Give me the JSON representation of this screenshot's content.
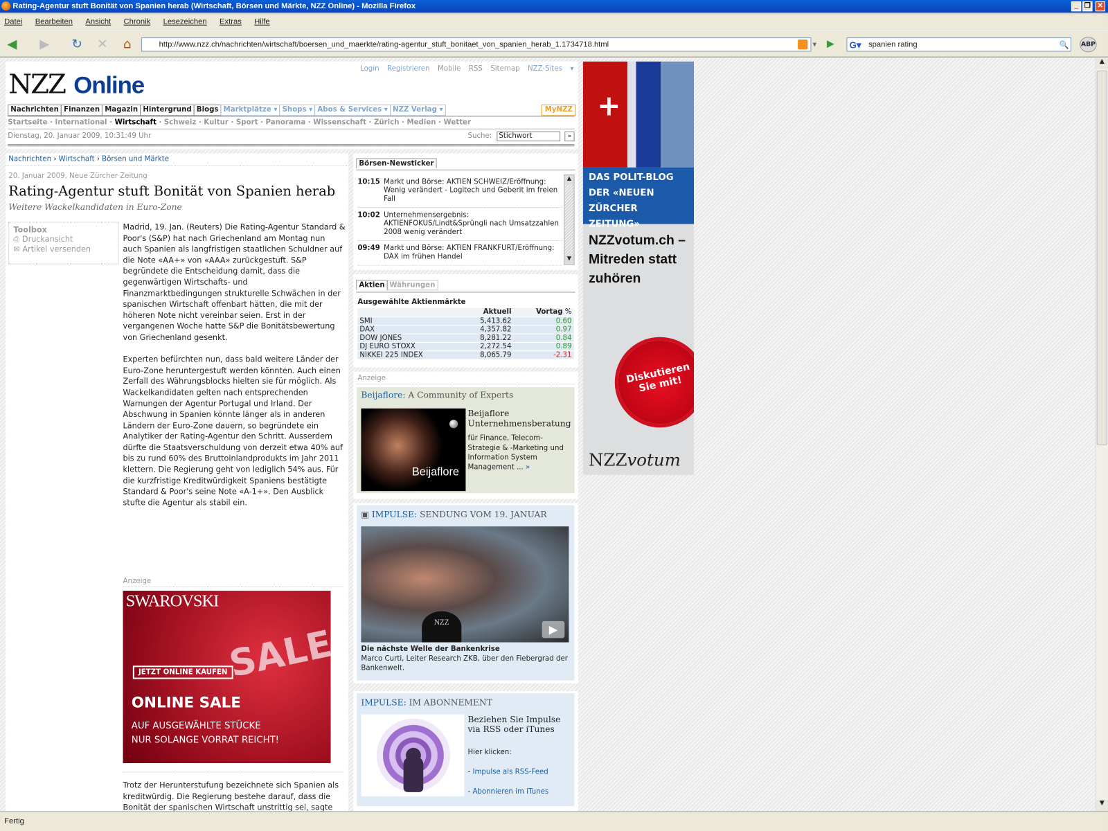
{
  "window": {
    "title": "Rating-Agentur stuft Bonität von Spanien herab (Wirtschaft, Börsen und Märkte, NZZ Online) - Mozilla Firefox"
  },
  "menu": [
    "Datei",
    "Bearbeiten",
    "Ansicht",
    "Chronik",
    "Lesezeichen",
    "Extras",
    "Hilfe"
  ],
  "toolbar": {
    "url": "http://www.nzz.ch/nachrichten/wirtschaft/boersen_und_maerkte/rating-agentur_stuft_bonitaet_von_spanien_herab_1.1734718.html",
    "search_value": "spanien rating",
    "abp": "ABP"
  },
  "status": "Fertig",
  "site": {
    "logo_nzz": "NZZ",
    "logo_online": "Online",
    "toplinks": [
      "Login",
      "Registrieren",
      "Mobile",
      "RSS",
      "Sitemap",
      "NZZ-Sites ▾"
    ],
    "mainnav": [
      "Nachrichten",
      "Finanzen",
      "Magazin",
      "Hintergrund",
      "Blogs"
    ],
    "mainnav_blue": [
      "Marktplätze ▾",
      "Shops ▾",
      "Abos & Services ▾",
      "NZZ Verlag ▾"
    ],
    "mynzz": "MyNZZ",
    "subnav": [
      "Startseite",
      "International",
      "Wirtschaft",
      "Schweiz",
      "Kultur",
      "Sport",
      "Panorama",
      "Wissenschaft",
      "Zürich",
      "Medien",
      "Wetter"
    ],
    "date": "Dienstag, 20. Januar 2009, 10:31:49 Uhr",
    "search_label": "Suche:",
    "search_value": "Stichwort",
    "search_go": "»"
  },
  "article": {
    "breadcrumb": [
      "Nachrichten",
      "Wirtschaft",
      "Börsen und Märkte"
    ],
    "dateline": "20. Januar 2009, Neue Zürcher Zeitung",
    "title": "Rating-Agentur stuft Bonität von Spanien herab",
    "subtitle": "Weitere Wackelkandidaten in Euro-Zone",
    "toolbox": {
      "title": "Toolbox",
      "print": "Druckansicht",
      "send": "Artikel versenden"
    },
    "p1": "Madrid, 19. Jan. (Reuters) Die Rating-Agentur Standard & Poor's (S&P) hat nach Griechenland am Montag nun auch Spanien als langfristigen staatlichen Schuldner auf die Note «AA+» von «AAA» zurückgestuft. S&P begründete die Entscheidung damit, dass die gegenwärtigen Wirtschafts- und Finanzmarktbedingungen strukturelle Schwächen in der spanischen Wirtschaft offenbart hätten, die mit der höheren Note nicht vereinbar seien. Erst in der vergangenen Woche hatte S&P die Bonitätsbewertung von Griechenland gesenkt.",
    "p2": "Experten befürchten nun, dass bald weitere Länder der Euro-Zone heruntergestuft werden könnten. Auch einen Zerfall des Währungsblocks hielten sie für möglich. Als Wackelkandidaten gelten nach entsprechenden Warnungen der Agentur Portugal und Irland. Der Abschwung in Spanien könnte länger als in anderen Ländern der Euro-Zone dauern, so begründete ein Analytiker der Rating-Agentur den Schritt. Ausserdem dürfte die Staatsverschuldung von derzeit etwa 40% auf bis zu rund 60% des Bruttoinlandprodukts im Jahr 2011 klettern. Die Regierung geht von lediglich 54% aus. Für die kurzfristige Kreditwürdigkeit Spaniens bestätigte Standard & Poor's seine Note «A-1+». Den Ausblick stufte die Agentur als stabil ein.",
    "ad_label": "Anzeige",
    "ad": {
      "brand": "SWAROVSKI",
      "sale": "SALE",
      "cta": "JETZT ONLINE KAUFEN",
      "headline": "ONLINE SALE",
      "line1": "AUF AUSGEWÄHLTE STÜCKE",
      "line2": "NUR SOLANGE VORRAT REICHT!"
    },
    "p3": "Trotz der Herunterstufung bezeichnete sich Spanien als kreditwürdig. Die Regierung bestehe darauf, dass die Bonität der spanischen Wirtschaft unstrittig sei, sagte eine Sprecherin des Wirtschaftsministeriums. Der Staat ergreife weiterhin alle Massnahmen, die zur Überwindung der Krise notwendig seien. Spaniens Wirtschaftsminister Pedro Solbes bezeichnete das neue Rating als immer noch recht positiv. Die"
  },
  "ticker": {
    "tab": "Börsen-Newsticker",
    "items": [
      {
        "time": "10:15",
        "text": "Markt und Börse: AKTIEN SCHWEIZ/Eröffnung: Wenig verändert - Logitech und Geberit im freien Fall"
      },
      {
        "time": "10:02",
        "text": "Unternehmensergebnis: AKTIENFOKUS/Lindt&Sprüngli nach Umsatzzahlen 2008 wenig verändert"
      },
      {
        "time": "09:49",
        "text": "Markt und Börse: AKTIEN FRANKFURT/Eröffnung: DAX im frühen Handel"
      }
    ]
  },
  "markets": {
    "tabs": [
      "Aktien",
      "Währungen"
    ],
    "title": "Ausgewählte Aktienmärkte",
    "col_current": "Aktuell",
    "col_prev": "Vortag",
    "col_pct": "%",
    "rows": [
      {
        "name": "SMI",
        "value": "5,413.62",
        "change": "0.60"
      },
      {
        "name": "DAX",
        "value": "4,357.82",
        "change": "0.97"
      },
      {
        "name": "DOW JONES",
        "value": "8,281.22",
        "change": "0.84"
      },
      {
        "name": "DJ EURO STOXX",
        "value": "2,272.54",
        "change": "0.89"
      },
      {
        "name": "NIKKEI 225 INDEX",
        "value": "8,065.79",
        "change": "-2.31"
      }
    ],
    "pos_color": "#2a9a2a",
    "neg_color": "#d02020"
  },
  "beija": {
    "label": "Anzeige",
    "brand": "Beijaflore:",
    "tagline": "A Community of Experts",
    "title": "Beijaflore Unternehmensberatung",
    "text": "für Finance, Telecom-Strategie & -Marketing und Information System Management ...",
    "more": "»",
    "logo": "Beijaflore"
  },
  "impulse": {
    "brand": "IMPULSE:",
    "heading": "SENDUNG VOM 19. JANUAR",
    "video_title": "Die nächste Welle der Bankenkrise",
    "video_text": "Marco Curti, Leiter Research ZKB, über den Fiebergrad der Bankenwelt.",
    "mic": "NZZ"
  },
  "impulse_abo": {
    "brand": "IMPULSE:",
    "heading": "IM ABONNEMENT",
    "title": "Beziehen Sie Impulse via RSS oder iTunes",
    "click": "Hier klicken:",
    "link1": "Impulse als RSS-Feed",
    "link2": "Abonnieren im iTunes"
  },
  "votum": {
    "blog": "DAS POLIT-BLOG DER «NEUEN ZÜRCHER ZEITUNG»",
    "headline": "NZZvotum.ch – Mitreden statt zuhören",
    "badge": "Diskutieren Sie mit!",
    "logo_nzz": "NZZ",
    "logo_votum": "votum"
  }
}
